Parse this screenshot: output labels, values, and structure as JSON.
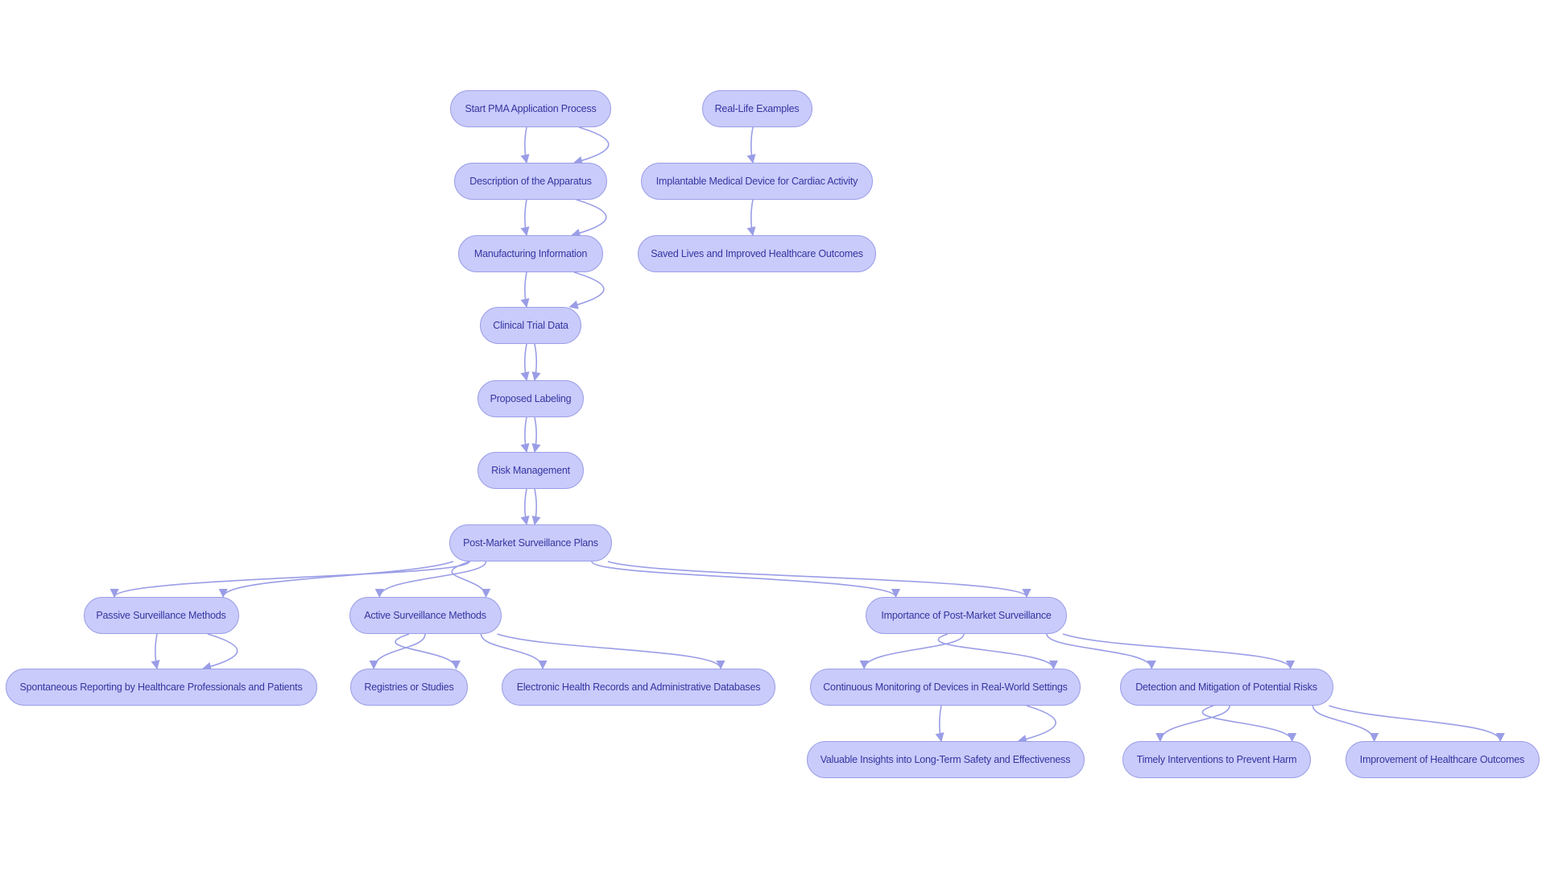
{
  "colors": {
    "node_fill": "#c9cbfb",
    "node_border": "#9c9fe6",
    "edge": "#9a9de6",
    "text": "#3535a0"
  },
  "nodes": [
    {
      "id": "start",
      "label": "Start PMA Application Process"
    },
    {
      "id": "desc",
      "label": "Description of the Apparatus"
    },
    {
      "id": "manu",
      "label": "Manufacturing Information"
    },
    {
      "id": "clin",
      "label": "Clinical Trial Data"
    },
    {
      "id": "prop",
      "label": "Proposed Labeling"
    },
    {
      "id": "risk",
      "label": "Risk Management"
    },
    {
      "id": "post",
      "label": "Post-Market Surveillance Plans"
    },
    {
      "id": "passive",
      "label": "Passive Surveillance Methods"
    },
    {
      "id": "active",
      "label": "Active Surveillance Methods"
    },
    {
      "id": "imp",
      "label": "Importance of Post-Market Surveillance"
    },
    {
      "id": "spont",
      "label": "Spontaneous Reporting by Healthcare Professionals and Patients"
    },
    {
      "id": "reg",
      "label": "Registries or Studies"
    },
    {
      "id": "ehr",
      "label": "Electronic Health Records and Administrative Databases"
    },
    {
      "id": "cont",
      "label": "Continuous Monitoring of Devices in Real-World Settings"
    },
    {
      "id": "det",
      "label": "Detection and Mitigation of Potential Risks"
    },
    {
      "id": "val",
      "label": "Valuable Insights into Long-Term Safety and Effectiveness"
    },
    {
      "id": "timely",
      "label": "Timely Interventions to Prevent Harm"
    },
    {
      "id": "improve",
      "label": "Improvement of Healthcare Outcomes"
    },
    {
      "id": "real",
      "label": "Real-Life Examples"
    },
    {
      "id": "implant",
      "label": "Implantable Medical Device for Cardiac Activity"
    },
    {
      "id": "saved",
      "label": "Saved Lives and Improved Healthcare Outcomes"
    }
  ],
  "edges": [
    [
      "start",
      "desc"
    ],
    [
      "start",
      "desc"
    ],
    [
      "desc",
      "manu"
    ],
    [
      "desc",
      "manu"
    ],
    [
      "manu",
      "clin"
    ],
    [
      "manu",
      "clin"
    ],
    [
      "clin",
      "prop"
    ],
    [
      "clin",
      "prop"
    ],
    [
      "prop",
      "risk"
    ],
    [
      "prop",
      "risk"
    ],
    [
      "risk",
      "post"
    ],
    [
      "risk",
      "post"
    ],
    [
      "post",
      "passive"
    ],
    [
      "post",
      "passive"
    ],
    [
      "post",
      "active"
    ],
    [
      "post",
      "active"
    ],
    [
      "post",
      "imp"
    ],
    [
      "post",
      "imp"
    ],
    [
      "passive",
      "spont"
    ],
    [
      "passive",
      "spont"
    ],
    [
      "active",
      "reg"
    ],
    [
      "active",
      "reg"
    ],
    [
      "active",
      "ehr"
    ],
    [
      "active",
      "ehr"
    ],
    [
      "imp",
      "cont"
    ],
    [
      "imp",
      "cont"
    ],
    [
      "imp",
      "det"
    ],
    [
      "imp",
      "det"
    ],
    [
      "cont",
      "val"
    ],
    [
      "cont",
      "val"
    ],
    [
      "det",
      "timely"
    ],
    [
      "det",
      "timely"
    ],
    [
      "det",
      "improve"
    ],
    [
      "det",
      "improve"
    ],
    [
      "real",
      "implant"
    ],
    [
      "implant",
      "saved"
    ]
  ]
}
